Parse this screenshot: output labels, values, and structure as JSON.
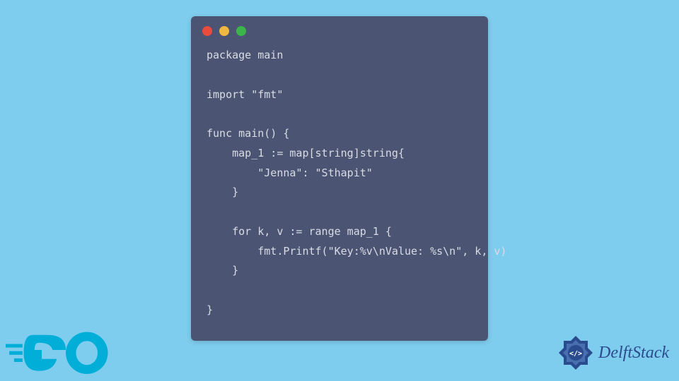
{
  "code": {
    "line1": "package main",
    "line2": "",
    "line3": "import \"fmt\"",
    "line4": "",
    "line5": "func main() {",
    "line6": "    map_1 := map[string]string{",
    "line7": "        \"Jenna\": \"Sthapit\"",
    "line8": "    }",
    "line9": "",
    "line10": "    for k, v := range map_1 {",
    "line11": "        fmt.Printf(\"Key:%v\\nValue: %s\\n\", k, v)",
    "line12": "    }",
    "line13": "",
    "line14": "}"
  },
  "logos": {
    "go": "GO",
    "delftstack": "DelftStack"
  },
  "colors": {
    "background": "#7fcdee",
    "window": "#4b5472",
    "go_logo": "#00aed8",
    "delft_badge": "#2a4b8d"
  }
}
